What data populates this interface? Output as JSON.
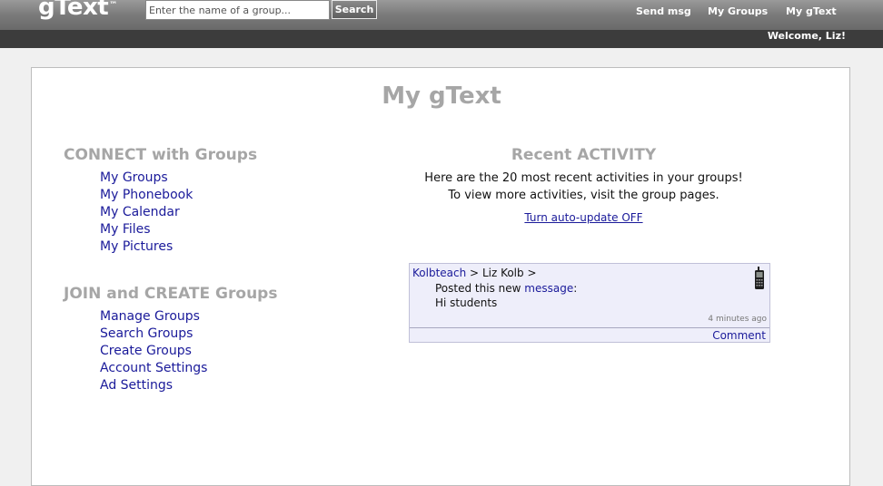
{
  "header": {
    "logo": "gText",
    "logo_mark": "™",
    "search_placeholder": "Enter the name of a group...",
    "search_button": "Search",
    "nav": [
      "Send msg",
      "My Groups",
      "My gText"
    ],
    "welcome": "Welcome, Liz!"
  },
  "page": {
    "title": "My gText"
  },
  "connect": {
    "title": "CONNECT with Groups",
    "links": [
      "My Groups",
      "My Phonebook",
      "My Calendar",
      "My Files",
      "My Pictures"
    ]
  },
  "join": {
    "title": "JOIN and CREATE Groups",
    "links": [
      "Manage Groups",
      "Search Groups",
      "Create Groups",
      "Account Settings",
      "Ad Settings"
    ]
  },
  "activity": {
    "title": "Recent ACTIVITY",
    "line1": "Here are the 20 most recent activities in your groups!",
    "line2": "To view more activities, visit the group pages.",
    "auto_update": "Turn auto-update OFF",
    "card": {
      "group": "Kolbteach",
      "sep1": ">",
      "user": "Liz Kolb",
      "sep2": ">",
      "action_prefix": "Posted this new",
      "action_link": "message",
      "action_suffix": ":",
      "content": "Hi students",
      "time": "4 minutes ago",
      "comment": "Comment",
      "icon": "cell-phone-icon"
    }
  },
  "colors": {
    "link": "#1a1a9a",
    "heading_gray": "#a6a6a6",
    "card_bg": "#eeeefa"
  }
}
